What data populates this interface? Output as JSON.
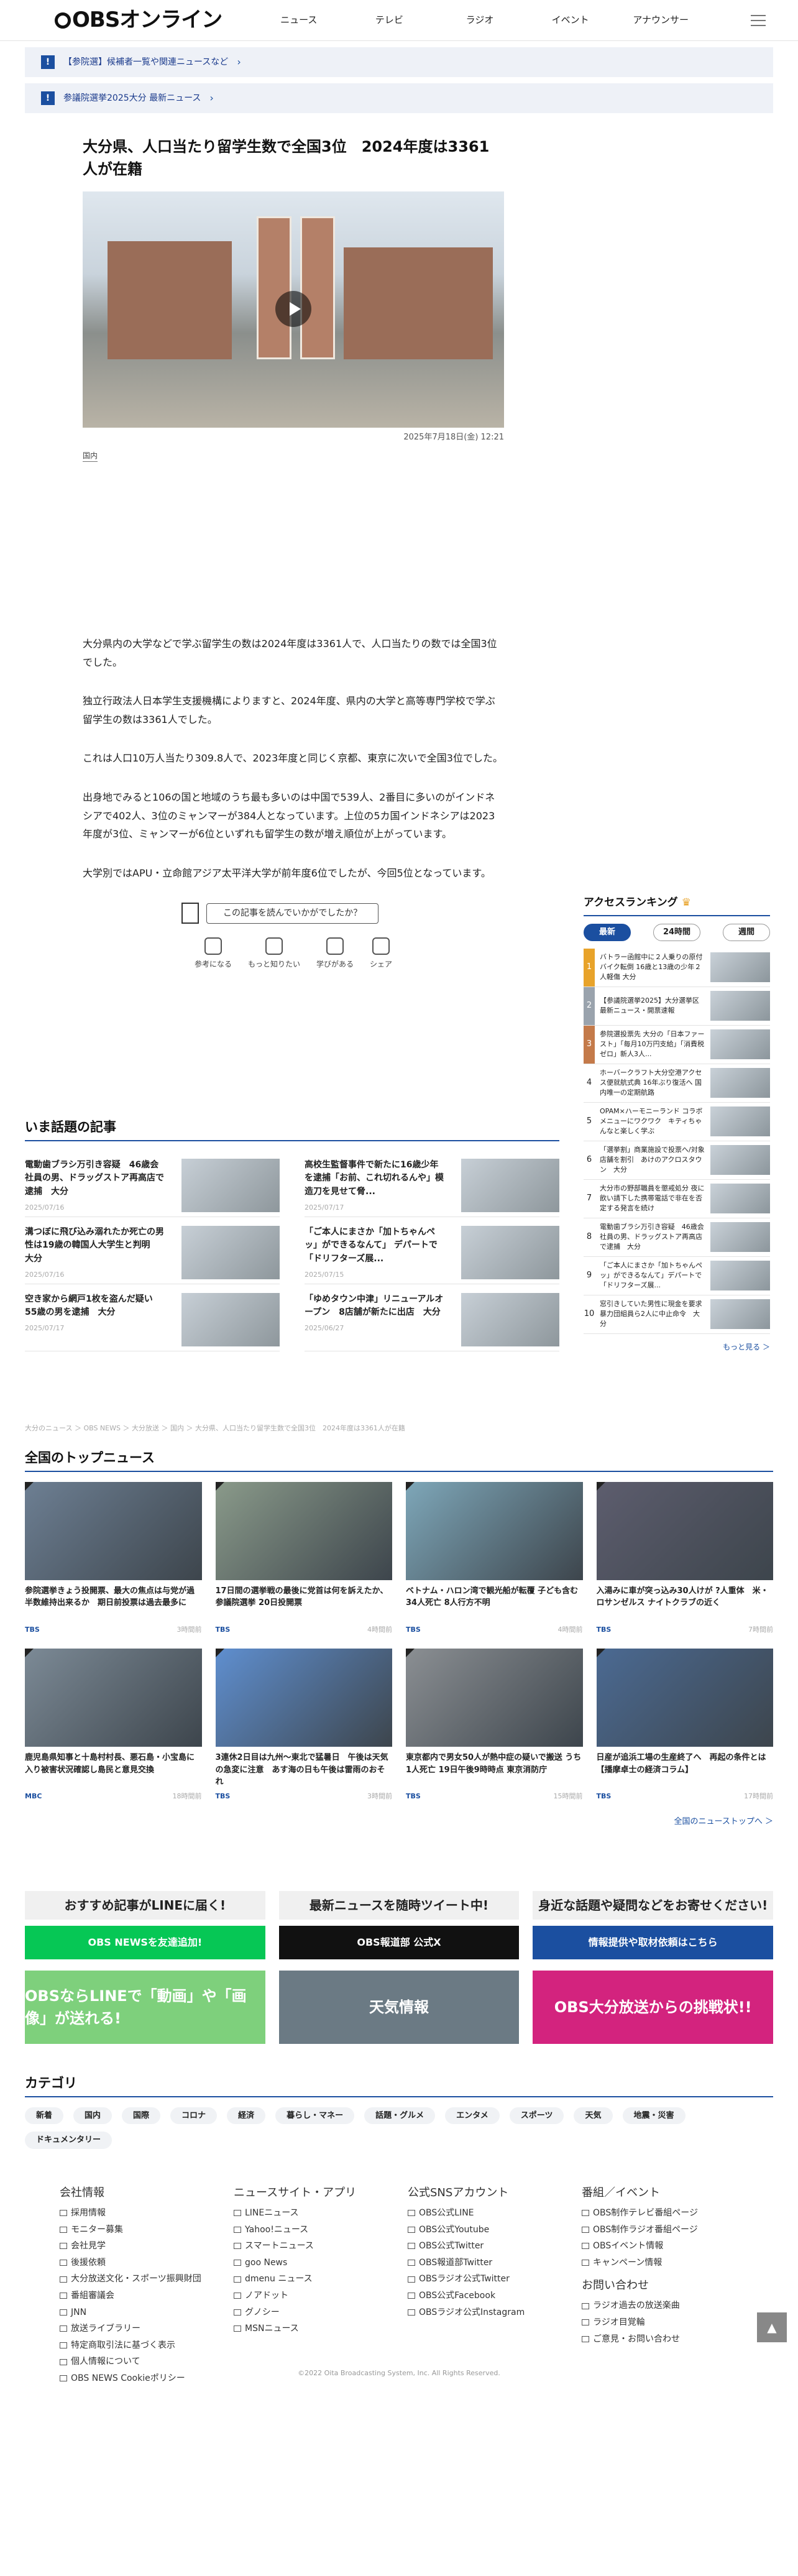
{
  "header": {
    "logo": "OBSオンライン",
    "nav": [
      "ニュース",
      "テレビ",
      "ラジオ",
      "イベント",
      "アナウンサー"
    ]
  },
  "banners": [
    {
      "text": "【参院選】候補者一覧や関連ニュースなど"
    },
    {
      "text": "参議院選挙2025大分 最新ニュース"
    }
  ],
  "article": {
    "title": "大分県、人口当たり留学生数で全国3位　2024年度は3361人が在籍",
    "date": "2025年7月18日(金) 12:21",
    "category": "国内",
    "paragraphs": [
      "大分県内の大学などで学ぶ留学生の数は2024年度は3361人で、人口当たりの数では全国3位でした。",
      "独立行政法人日本学生支援機構によりますと、2024年度、県内の大学と高等専門学校で学ぶ留学生の数は3361人でした。",
      "これは人口10万人当たり309.8人で、2023年度と同じく京都、東京に次いで全国3位でした。",
      "出身地でみると106の国と地域のうち最も多いのは中国で539人、2番目に多いのがインドネシアで402人、3位のミャンマーが384人となっています。上位の5カ国インドネシアは2023年度が3位、ミャンマーが6位といずれも留学生の数が増え順位が上がっています。",
      "大学別ではAPU・立命館アジア太平洋大学が前年度6位でしたが、今回5位となっています。"
    ],
    "feedback_button": "この記事を読んでいかがでしたか？",
    "reactions": [
      "参考になる",
      "もっと知りたい",
      "学びがある",
      "シェア"
    ]
  },
  "trending": {
    "title": "いま話題の記事",
    "items": [
      {
        "title": "電動歯ブラシ万引き容疑　46歳会社員の男、ドラッグストア再高店で逮捕　大分",
        "date": "2025/07/16"
      },
      {
        "title": "高校生監督事件で新たに16歳少年を逮捕「お前、これ切れるんや」模造刀を見せて脅...",
        "date": "2025/07/17"
      },
      {
        "title": "溝つぼに飛び込み溺れたか死亡の男性は19歳の韓国人大学生と判明　大分",
        "date": "2025/07/16"
      },
      {
        "title": "「ご本人にまさか「加トちゃんペッ」ができるなんて」 デパートで「ドリフターズ展...",
        "date": "2025/07/15"
      },
      {
        "title": "空き家から網戸1枚を盗んだ疑い　55歳の男を逮捕　大分",
        "date": "2025/07/17"
      },
      {
        "title": "「ゆめタウン中津」リニューアルオープン　8店舗が新たに出店　大分",
        "date": "2025/06/27"
      }
    ]
  },
  "breadcrumb": "大分のニュース ＞ OBS NEWS ＞ 大分放送 ＞ 国内 ＞ 大分県、人口当たり留学生数で全国3位　2024年度は3361人が在籍",
  "ranking": {
    "title": "アクセスランキング",
    "tabs": [
      "最新",
      "24時間",
      "週間"
    ],
    "items": [
      {
        "num": "1",
        "title": "バトラー函館中に２人乗りの原付バイク転倒 16歳と13歳の少年２人軽傷 大分",
        "color": "#e8a32a"
      },
      {
        "num": "2",
        "title": "【参議院選挙2025】大分選挙区　最新ニュース・開票速報",
        "color": "#9aa3ad"
      },
      {
        "num": "3",
        "title": "参院選投票先 大分の「日本ファースト」「毎月10万円支給」「消費税ゼロ」新人3人...",
        "color": "#c47a4a"
      },
      {
        "num": "4",
        "title": "ホーバークラフト大分空港アクセス便就航式典 16年ぶり復活へ 国内唯一の定期航路",
        "color": ""
      },
      {
        "num": "5",
        "title": "OPAM×ハーモニーランド コラボメニューにワクワク　キティちゃんなと楽しく学ぶ",
        "color": ""
      },
      {
        "num": "6",
        "title": "「選挙割」商業施設で投票へ/対象店舗を割引　あけのアクロスタウン　大分",
        "color": ""
      },
      {
        "num": "7",
        "title": "大分市の野部職員を懲戒処分 夜に飲い請下した携帯電話で非在を否定する発言を続け",
        "color": ""
      },
      {
        "num": "8",
        "title": "電動歯ブラシ万引き容疑　46歳会社員の男、ドラッグストア再高店で逮捕　大分",
        "color": ""
      },
      {
        "num": "9",
        "title": "「ご本人にまさか「加トちゃんペッ」ができるなんて」デパートで「ドリフターズ展...",
        "color": ""
      },
      {
        "num": "10",
        "title": "窓引きしていた男性に現金を要求 暴力団組員ら2人に中止命令　大分",
        "color": ""
      }
    ],
    "more": "もっと見る ＞"
  },
  "top_news": {
    "title": "全国のトップニュース",
    "items": [
      {
        "title": "参院選挙きょう投開票、最大の焦点は与党が過半数維持出来るか　期日前投票は過去最多に",
        "source": "TBS",
        "ago": "3時間前",
        "color": "#6d7f93"
      },
      {
        "title": "17日間の選挙戦の最後に党首は何を訴えたか、参議院選挙 20日投開票",
        "source": "TBS",
        "ago": "4時間前",
        "color": "#8a9a8a"
      },
      {
        "title": "ベトナム・ハロン湾で観光船が転覆 子ども含む34人死亡 8人行方不明",
        "source": "TBS",
        "ago": "4時間前",
        "color": "#7ea7b9"
      },
      {
        "title": "入湯みに車が突っ込み30人けが ?人重体　米・ロサンゼルス ナイトクラブの近く",
        "source": "TBS",
        "ago": "7時間前",
        "color": "#5d5d6e"
      },
      {
        "title": "鹿児島県知事と十島村村長、悪石島・小宝島に入り被害状況確認し島民と意見交換",
        "source": "MBC",
        "ago": "18時間前",
        "color": "#7c8a96"
      },
      {
        "title": "3連休2日目は九州〜東北で猛暑日　午後は天気の急変に注意　あす海の日も午後は雷雨のおそれ",
        "source": "TBS",
        "ago": "3時間前",
        "color": "#5f8fd0"
      },
      {
        "title": "東京都内で男女50人が熱中症の疑いで搬送 うち1人死亡 19日午後9時時点 東京消防庁",
        "source": "TBS",
        "ago": "15時間前",
        "color": "#8b8f93"
      },
      {
        "title": "日産が追浜工場の生産終了へ　再起の条件とは【播摩卓士の経済コラム】",
        "source": "TBS",
        "ago": "17時間前",
        "color": "#4b6a93"
      }
    ],
    "more": "全国のニューストップへ ＞"
  },
  "promos": [
    {
      "heading": "おすすめ記事がLINEに届く!",
      "button": "OBS NEWSを友達追加!",
      "btn_color": "#06c755",
      "image_text": "OBSならLINEで「動画」や「画像」が送れる!",
      "img_color": "#7ed07c"
    },
    {
      "heading": "最新ニュースを随時ツイート中!",
      "button": "OBS報道部 公式X",
      "btn_color": "#111111",
      "image_text": "天気情報",
      "img_color": "#6b7a84"
    },
    {
      "heading": "身近な話題や疑問などをお寄せください!",
      "button": "情報提供や取材依頼はこちら",
      "btn_color": "#1b4fa0",
      "image_text": "OBS大分放送からの挑戦状!!",
      "img_color": "#d3237e"
    }
  ],
  "categories": {
    "title": "カテゴリ",
    "chips": [
      "新着",
      "国内",
      "国際",
      "コロナ",
      "経済",
      "暮らし・マネー",
      "話題・グルメ",
      "エンタメ",
      "スポーツ",
      "天気",
      "地震・災害",
      "ドキュメンタリー"
    ]
  },
  "footer": [
    {
      "heading": "会社情報",
      "links": [
        "採用情報",
        "モニター募集",
        "会社見学",
        "後援依頼",
        "大分放送文化・スポーツ振興財団",
        "番組審議会",
        "JNN",
        "放送ライブラリー",
        "特定商取引法に基づく表示",
        "個人情報について",
        "OBS NEWS Cookieポリシー"
      ]
    },
    {
      "heading": "ニュースサイト・アプリ",
      "links": [
        "LINEニュース",
        "Yahoo!ニュース",
        "スマートニュース",
        "goo News",
        "dmenu ニュース",
        "ノアドット",
        "グノシー",
        "MSNニュース"
      ]
    },
    {
      "heading": "公式SNSアカウント",
      "links": [
        "OBS公式LINE",
        "OBS公式Youtube",
        "OBS公式Twitter",
        "OBS報道部Twitter",
        "OBSラジオ公式Twitter",
        "OBS公式Facebook",
        "OBSラジオ公式Instagram"
      ]
    },
    {
      "heading": "番組／イベント",
      "links": [
        "OBS制作テレビ番組ページ",
        "OBS制作ラジオ番組ページ",
        "OBSイベント情報",
        "キャンペーン情報"
      ],
      "heading2": "お問い合わせ",
      "links2": [
        "ラジオ過去の放送楽曲",
        "ラジオ目覚輪",
        "ご意見・お問い合わせ"
      ]
    }
  ],
  "copyright": "©2022 Oita Broadcasting System, Inc. All Rights Reserved."
}
